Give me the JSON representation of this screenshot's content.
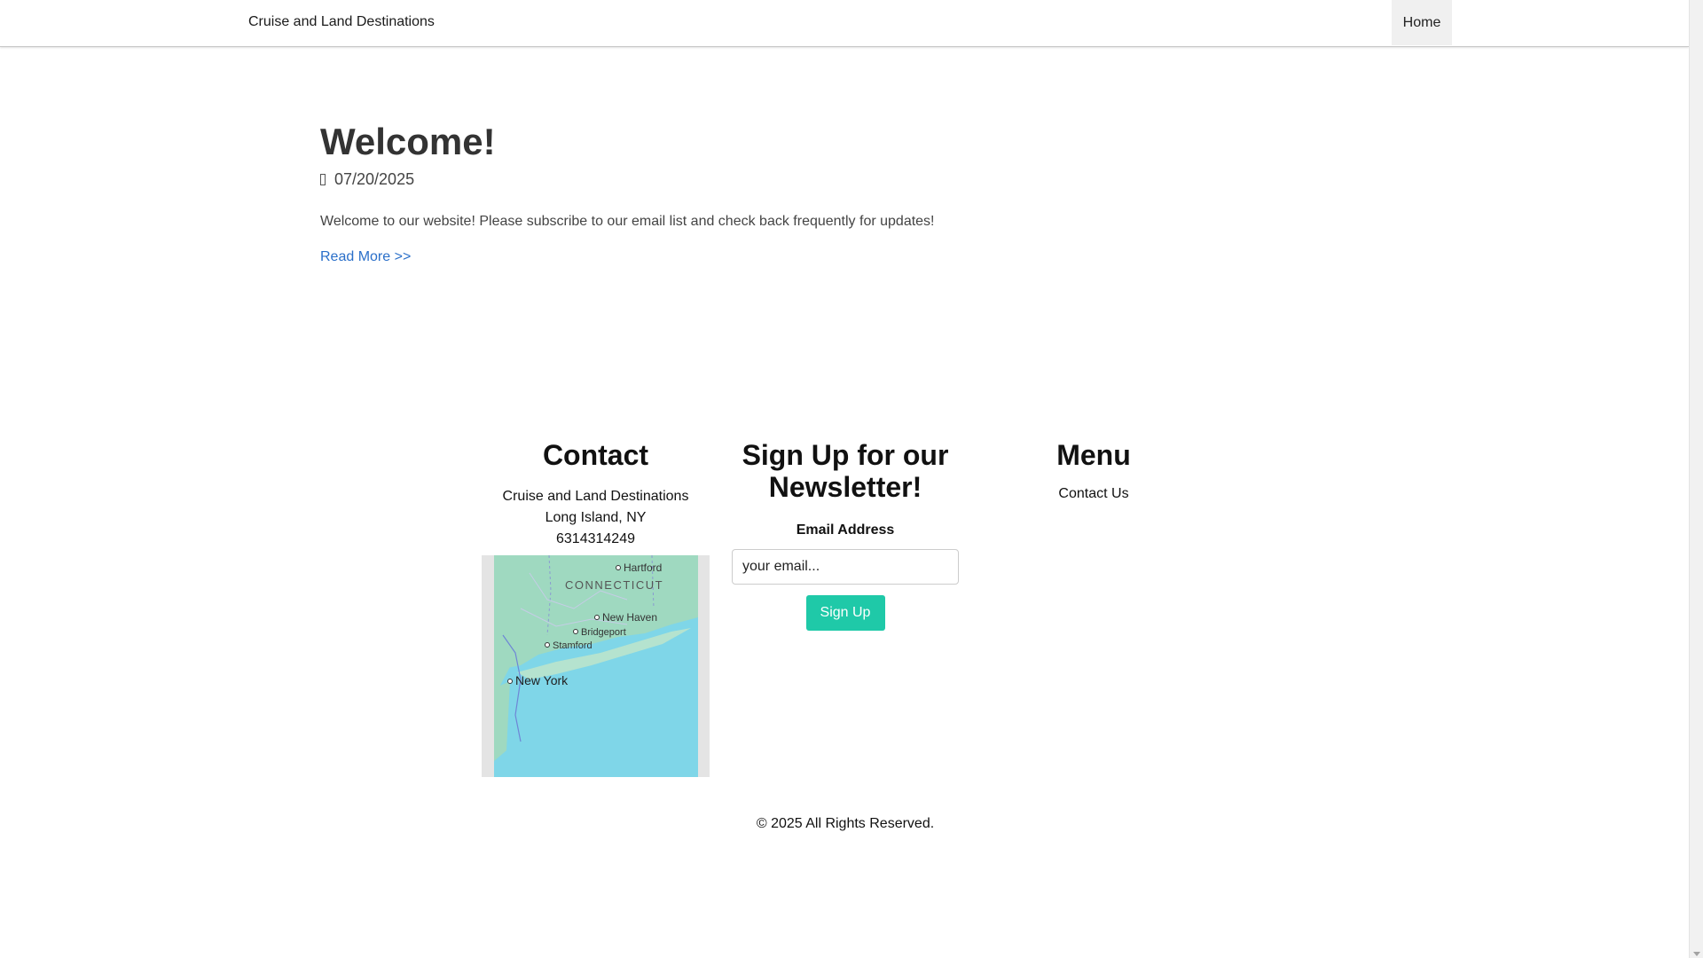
{
  "navbar": {
    "brand": "Cruise and Land Destinations",
    "home_label": "Home"
  },
  "post": {
    "title": "Welcome!",
    "date": "07/20/2025",
    "body": "Welcome to our website! Please subscribe to our email list and check back frequently for updates!",
    "read_more": "Read More >>"
  },
  "footer": {
    "contact": {
      "heading": "Contact",
      "name": "Cruise and Land Destinations",
      "location": "Long Island, NY",
      "phone": "6314314249",
      "map": {
        "labels": [
          "Hartford",
          "CONNECTICUT",
          "New Haven",
          "Bridgeport",
          "Stamford",
          "New York"
        ]
      }
    },
    "newsletter": {
      "heading": "Sign Up for our Newsletter!",
      "email_label": "Email Address",
      "email_placeholder": "your email...",
      "button_label": "Sign Up"
    },
    "menu": {
      "heading": "Menu",
      "items": [
        "Contact Us"
      ]
    },
    "copyright": "© 2025 All Rights Reserved."
  },
  "colors": {
    "accent_button": "#1fc9a8",
    "link": "#2a6fc9",
    "water": "#7fd6e8",
    "land": "#9fd9c0"
  }
}
